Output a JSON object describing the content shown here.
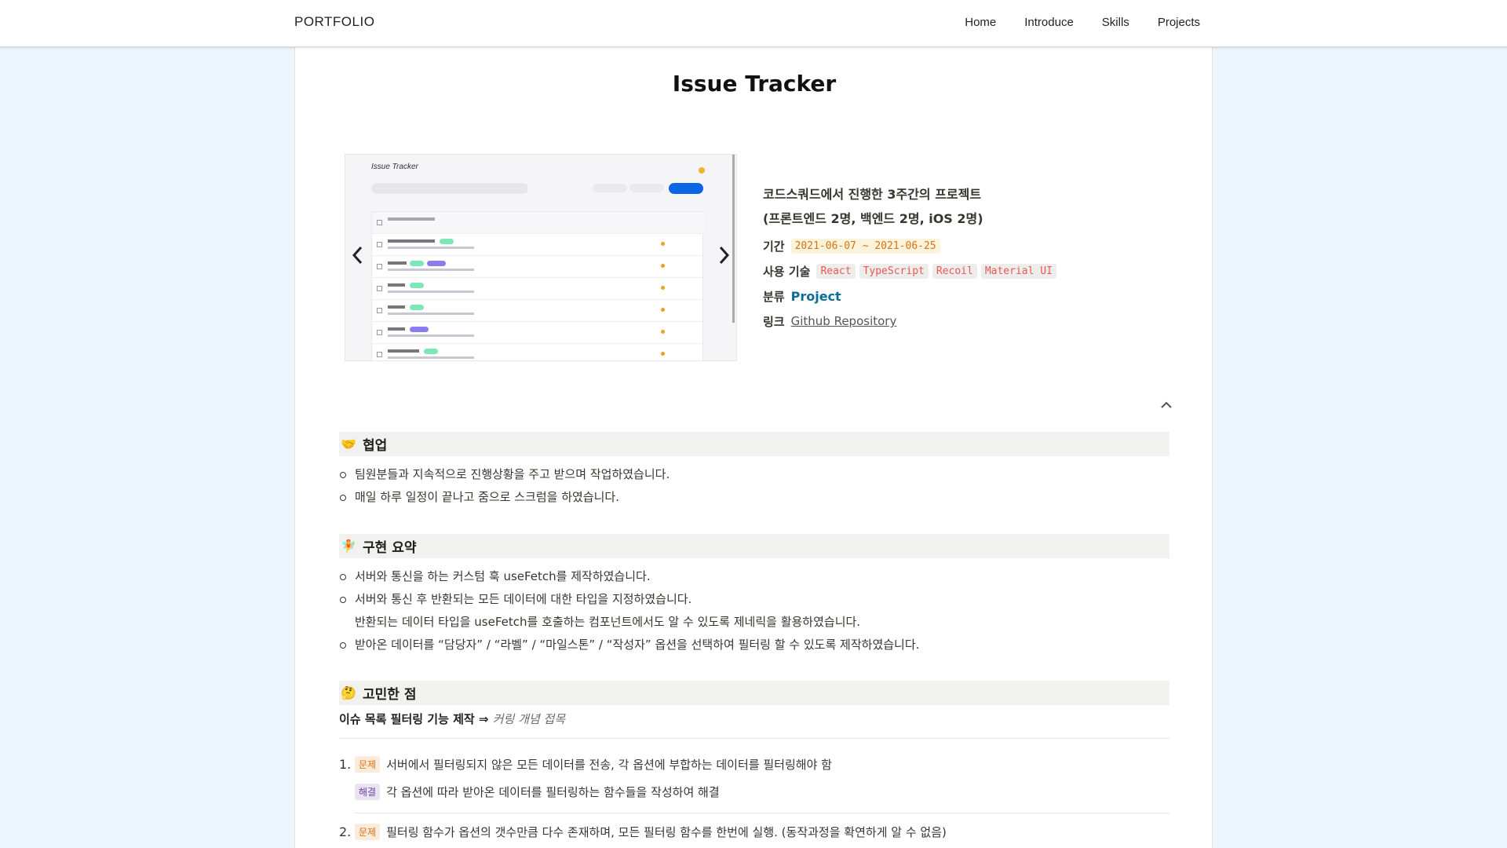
{
  "nav": {
    "brand": "PORTFOLIO",
    "links": [
      "Home",
      "Introduce",
      "Skills",
      "Projects"
    ]
  },
  "project": {
    "title": "Issue Tracker",
    "desc1": "코드스쿼드에서 진행한 3주간의 프로젝트",
    "desc2": "(프론트엔드 2명, 백엔드 2명, iOS 2명)",
    "period_label": "기간",
    "period": "2021-06-07 ~ 2021-06-25",
    "tech_label": "사용 기술",
    "techs": [
      "React",
      "TypeScript",
      "Recoil",
      "Material UI"
    ],
    "category_label": "분류",
    "category": "Project",
    "link_label": "링크",
    "link_text": "Github Repository"
  },
  "carousel": {
    "screenshot_title": "Issue Tracker",
    "prev_icon": "chevron-left-icon",
    "next_icon": "chevron-right-icon"
  },
  "sections": {
    "collab": {
      "emoji": "🤝",
      "title": "협업",
      "items": [
        "팀원분들과 지속적으로 진행상황을 주고 받으며 작업하였습니다.",
        "매일 하루 일정이 끝나고 줌으로 스크럼을 하였습니다."
      ]
    },
    "impl": {
      "emoji": "🧚",
      "title": "구현 요약",
      "items": [
        "서버와 통신을 하는 커스텀 훅 useFetch를 제작하였습니다.",
        "서버와 통신 후 반환되는 모든 데이터에 대한 타입을 지정하였습니다.",
        "받아온 데이터를 “담당자” / “라벨” / “마일스톤” / “작성자” 옵션을 선택하여 필터링 할 수 있도록 제작하였습니다."
      ],
      "continuation": "반환되는 데이터 타입을 useFetch를 호출하는 컴포넌트에서도 알 수 있도록 제네릭을 활용하였습니다."
    },
    "concern": {
      "emoji": "🤔",
      "title": "고민한 점",
      "subheading": "이슈 목록 필터링 기능 제작 ⇒",
      "subheading_italic": "커링 개념 접목",
      "problem_label": "문제",
      "solution_label": "해결",
      "items": [
        {
          "num": "1.",
          "problem": "서버에서 필터링되지 않은 모든 데이터를 전송, 각 옵션에 부합하는 데이터를 필터링해야 함",
          "solution": "각 옵션에 따라 받아온 데이터를 필터링하는 함수들을 작성하여 해결"
        },
        {
          "num": "2.",
          "problem": "필터링 함수가 옵션의 갯수만큼 다수 존재하며, 모든 필터링 함수를 한번에 실행. (동작과정을 확연하게 알 수 없음)"
        }
      ]
    }
  },
  "colors": {
    "accent_blue": "#0b6e99",
    "code_red": "#eb5757",
    "code_orange": "#d9730d",
    "page_bg": "#ecf4fc"
  }
}
